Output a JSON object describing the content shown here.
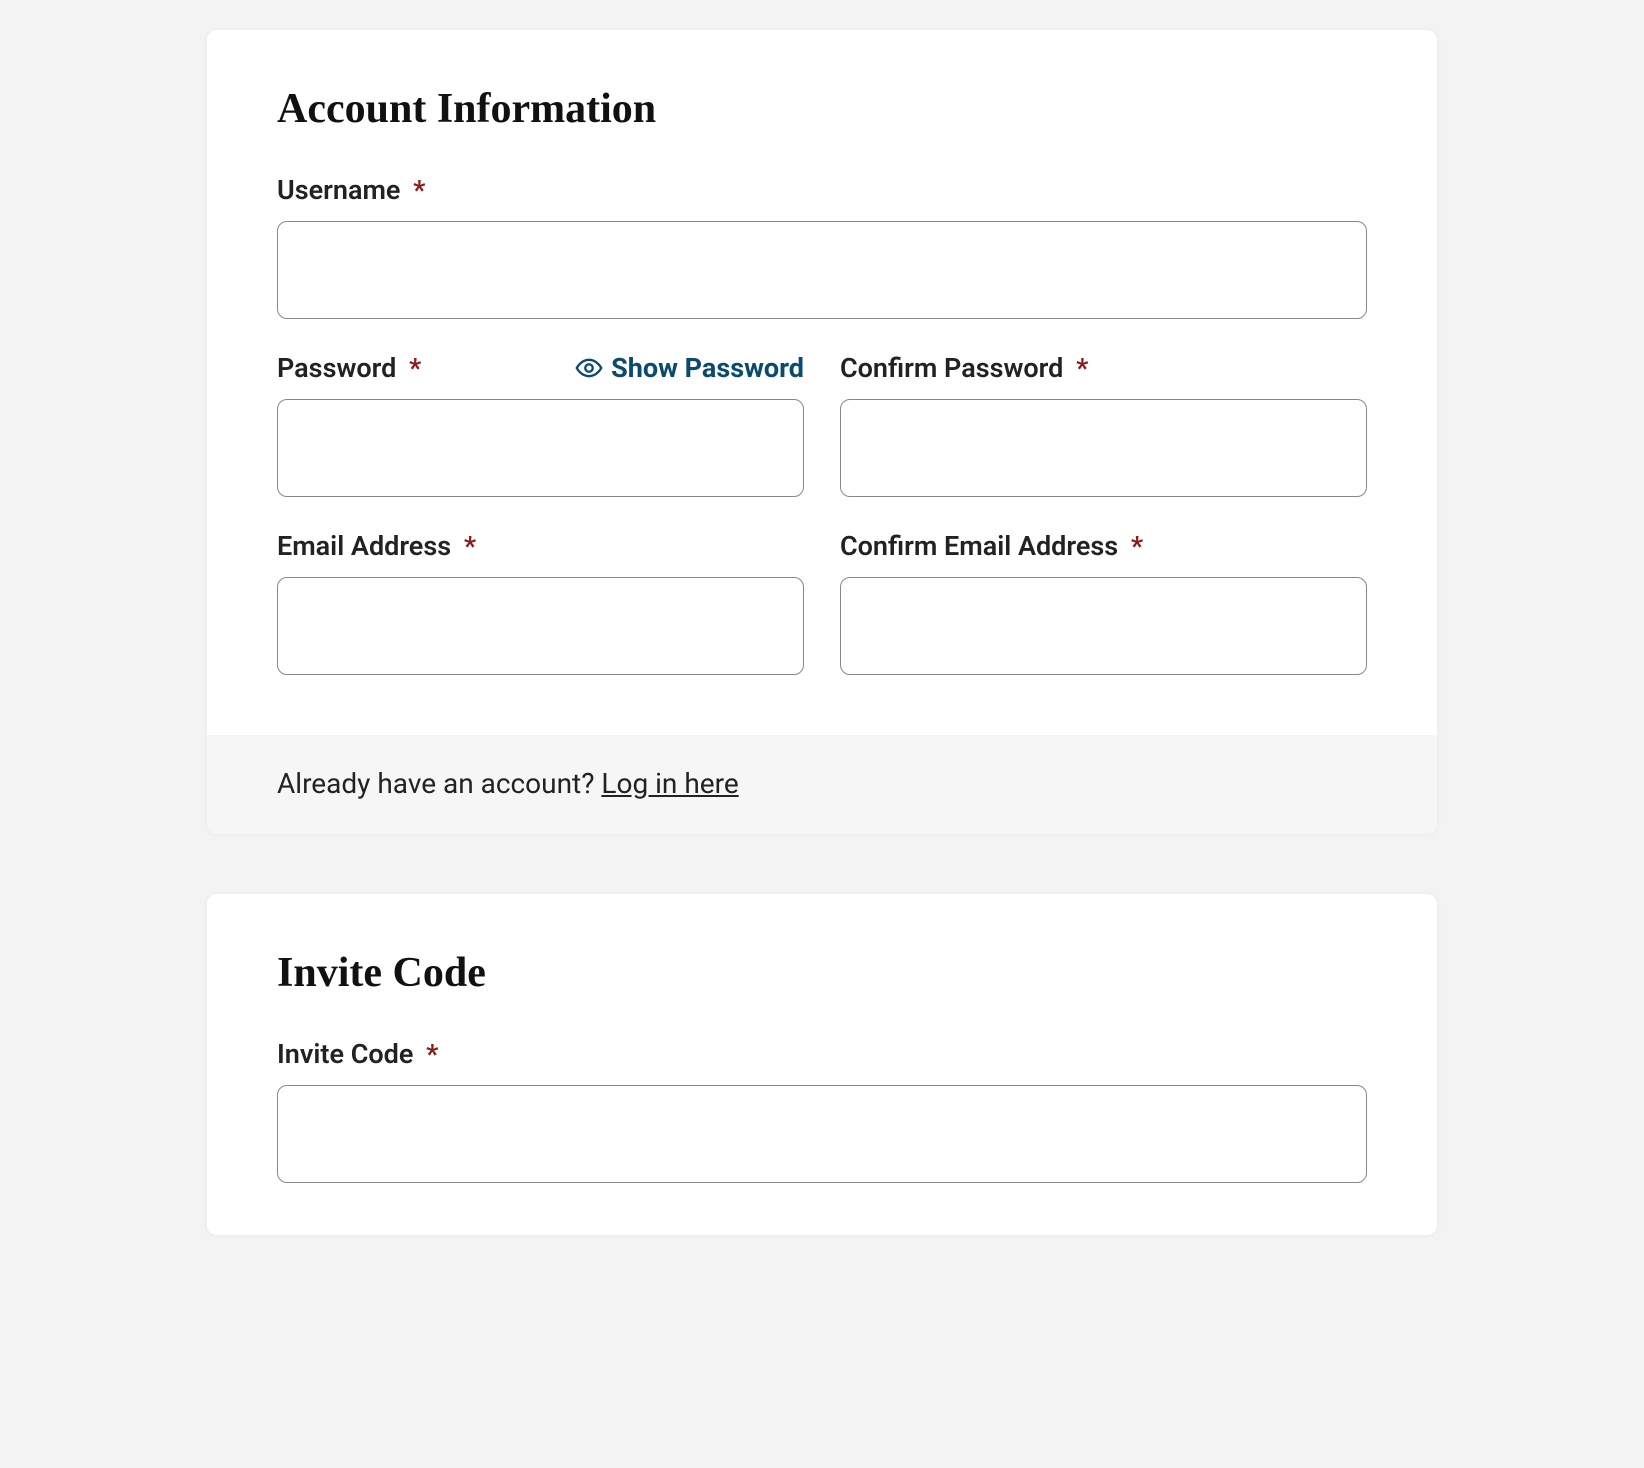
{
  "account": {
    "heading": "Account Information",
    "username": {
      "label": "Username",
      "value": ""
    },
    "password": {
      "label": "Password",
      "value": "",
      "show_toggle_label": "Show Password"
    },
    "confirm_password": {
      "label": "Confirm Password",
      "value": ""
    },
    "email": {
      "label": "Email Address",
      "value": ""
    },
    "confirm_email": {
      "label": "Confirm Email Address",
      "value": ""
    },
    "footer": {
      "prompt_prefix": "Already have an account? ",
      "login_link_text": "Log in here"
    }
  },
  "invite": {
    "heading": "Invite Code",
    "code": {
      "label": "Invite Code",
      "value": ""
    }
  },
  "required_marker": "*"
}
